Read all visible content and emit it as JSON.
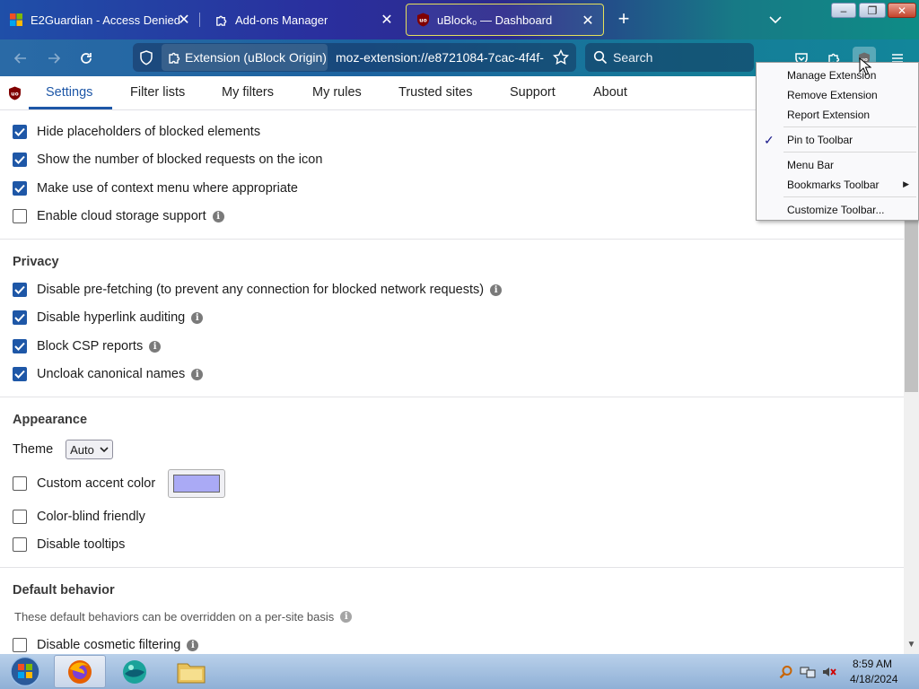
{
  "tabs": [
    {
      "title": "E2Guardian - Access Denied",
      "favicon": "windows-logo-icon"
    },
    {
      "title": "Add-ons Manager",
      "favicon": "puzzle-icon"
    },
    {
      "title": "uBlock₀ — Dashboard",
      "favicon": "ublock-icon",
      "active": true
    }
  ],
  "window_controls": {
    "minimize": "–",
    "restore": "❐",
    "close": "✕"
  },
  "navbar": {
    "identity_label": "Extension (uBlock Origin)",
    "url": "moz-extension://e8721084-7cac-4f4f-",
    "search_placeholder": "Search"
  },
  "ext_tabs": [
    "Settings",
    "Filter lists",
    "My filters",
    "My rules",
    "Trusted sites",
    "Support",
    "About"
  ],
  "settings": {
    "general": [
      {
        "label": "Hide placeholders of blocked elements",
        "checked": true,
        "info": false
      },
      {
        "label": "Show the number of blocked requests on the icon",
        "checked": true,
        "info": false
      },
      {
        "label": "Make use of context menu where appropriate",
        "checked": true,
        "info": false
      },
      {
        "label": "Enable cloud storage support",
        "checked": false,
        "info": true
      }
    ],
    "privacy_heading": "Privacy",
    "privacy": [
      {
        "label": "Disable pre-fetching (to prevent any connection for blocked network requests)",
        "checked": true,
        "info": true
      },
      {
        "label": "Disable hyperlink auditing",
        "checked": true,
        "info": true
      },
      {
        "label": "Block CSP reports",
        "checked": true,
        "info": true
      },
      {
        "label": "Uncloak canonical names",
        "checked": true,
        "info": true
      }
    ],
    "appearance_heading": "Appearance",
    "theme_label": "Theme",
    "theme_value": "Auto",
    "appearance": [
      {
        "label": "Custom accent color",
        "checked": false
      },
      {
        "label": "Color-blind friendly",
        "checked": false
      },
      {
        "label": "Disable tooltips",
        "checked": false
      }
    ],
    "accent_color": "#aaaaf5",
    "default_heading": "Default behavior",
    "default_desc": "These default behaviors can be overridden on a per-site basis",
    "default": [
      {
        "label": "Disable cosmetic filtering",
        "checked": false,
        "info": true
      }
    ]
  },
  "context_menu": {
    "items": [
      "Manage Extension",
      "Remove Extension",
      "Report Extension",
      "Pin to Toolbar",
      "Menu Bar",
      "Bookmarks Toolbar",
      "Customize Toolbar..."
    ],
    "checked_item": "Pin to Toolbar"
  },
  "taskbar": {
    "time": "8:59 AM",
    "date": "4/18/2024"
  },
  "colors": {
    "accent": "#1e57a7",
    "checkbox_on": "#1e57a7"
  }
}
